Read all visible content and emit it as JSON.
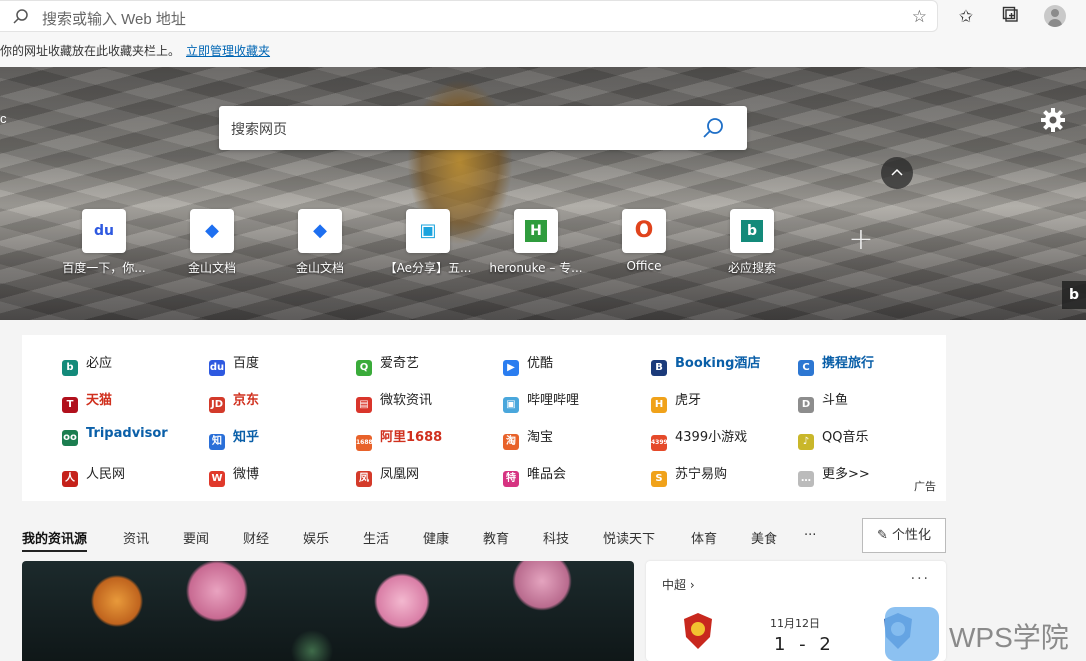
{
  "toolbar": {
    "address_placeholder": "搜索或输入 Web 地址",
    "favorites_message": "你的网址收藏放在此收藏夹栏上。",
    "manage_favorites_link": "立即管理收藏夹"
  },
  "hero": {
    "edge_letter": "c",
    "search_placeholder": "搜索网页",
    "tiles": [
      {
        "label": "百度一下，你...",
        "icon": "baidu-icon",
        "glyph": "du",
        "color": "#2e59e0"
      },
      {
        "label": "金山文档",
        "icon": "kdocs-icon",
        "glyph": "◆",
        "color": "#1e6ff0"
      },
      {
        "label": "金山文档",
        "icon": "kdocs-icon",
        "glyph": "◆",
        "color": "#1e6ff0"
      },
      {
        "label": "【Ae分享】五...",
        "icon": "bilibili-icon",
        "glyph": "▣",
        "color": "#1aa3de"
      },
      {
        "label": "heronuke – 专...",
        "icon": "h-icon",
        "glyph": "H",
        "color": "#2f9c3d"
      },
      {
        "label": "Office",
        "icon": "office-icon",
        "glyph": "O",
        "color": "#e0431c"
      },
      {
        "label": "必应搜索",
        "icon": "bing-icon",
        "glyph": "b",
        "color": "#138a7a"
      }
    ],
    "bing_corner": "b"
  },
  "links": {
    "items": [
      {
        "label": "必应",
        "style": "",
        "glyph": "b",
        "color": "#138a7a"
      },
      {
        "label": "百度",
        "style": "",
        "glyph": "du",
        "color": "#2e59e0"
      },
      {
        "label": "爱奇艺",
        "style": "",
        "glyph": "Q",
        "color": "#3aab3a"
      },
      {
        "label": "优酷",
        "style": "",
        "glyph": "▶",
        "color": "#2a7df0"
      },
      {
        "label": "Booking酒店",
        "style": "blue",
        "glyph": "B",
        "color": "#1b3a7a"
      },
      {
        "label": "携程旅行",
        "style": "blue",
        "glyph": "C",
        "color": "#2d77d2"
      },
      {
        "label": "天猫",
        "style": "red",
        "glyph": "T",
        "color": "#b1101c"
      },
      {
        "label": "京东",
        "style": "red",
        "glyph": "JD",
        "color": "#d33a2a"
      },
      {
        "label": "微软资讯",
        "style": "",
        "glyph": "▤",
        "color": "#d9352b"
      },
      {
        "label": "哔哩哔哩",
        "style": "",
        "glyph": "▣",
        "color": "#4aa7dc"
      },
      {
        "label": "虎牙",
        "style": "",
        "glyph": "H",
        "color": "#f0a21a"
      },
      {
        "label": "斗鱼",
        "style": "",
        "glyph": "D",
        "color": "#8d8d8d"
      },
      {
        "label": "Tripadvisor",
        "style": "blue",
        "glyph": "oo",
        "color": "#1b7d4f"
      },
      {
        "label": "知乎",
        "style": "blue",
        "glyph": "知",
        "color": "#2a6fd8"
      },
      {
        "label": "阿里1688",
        "style": "red",
        "glyph": "1688",
        "color": "#e8622a"
      },
      {
        "label": "淘宝",
        "style": "",
        "glyph": "淘",
        "color": "#e8622a"
      },
      {
        "label": "4399小游戏",
        "style": "",
        "glyph": "4399",
        "color": "#e54a2a"
      },
      {
        "label": "QQ音乐",
        "style": "",
        "glyph": "♪",
        "color": "#c9b72a"
      },
      {
        "label": "人民网",
        "style": "",
        "glyph": "人",
        "color": "#c5211a"
      },
      {
        "label": "微博",
        "style": "",
        "glyph": "W",
        "color": "#e0392b"
      },
      {
        "label": "凤凰网",
        "style": "",
        "glyph": "凤",
        "color": "#d43a2a"
      },
      {
        "label": "唯品会",
        "style": "",
        "glyph": "特",
        "color": "#d63381"
      },
      {
        "label": "苏宁易购",
        "style": "",
        "glyph": "S",
        "color": "#f0a21a"
      },
      {
        "label": "更多>>",
        "style": "",
        "glyph": "…",
        "color": "#bbbbbb"
      }
    ],
    "ad_label": "广告"
  },
  "feed": {
    "tabs": [
      "我的资讯源",
      "资讯",
      "要闻",
      "财经",
      "娱乐",
      "生活",
      "健康",
      "教育",
      "科技",
      "悦读天下",
      "体育",
      "美食",
      "···"
    ],
    "personalize_label": "个性化"
  },
  "sports": {
    "league": "中超",
    "date": "11月12日",
    "score": "1 - 2"
  },
  "watermark": {
    "text": "WPS学院"
  }
}
